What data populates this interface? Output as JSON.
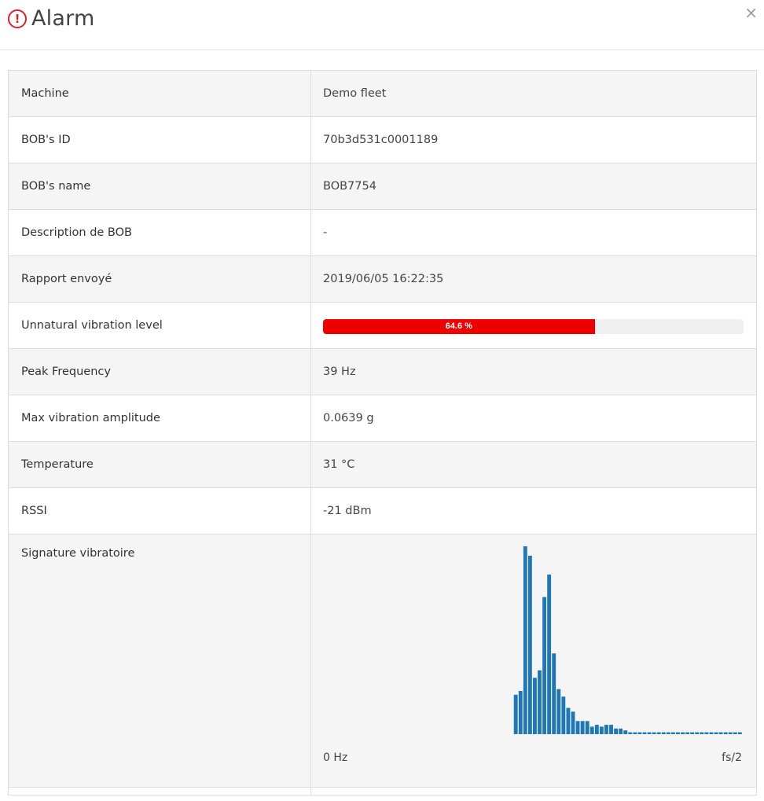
{
  "header": {
    "title": "Alarm",
    "close_label": "×",
    "alert_glyph": "!"
  },
  "rows": [
    {
      "label": "Machine",
      "value": "Demo fleet"
    },
    {
      "label": "BOB's ID",
      "value": "70b3d531c0001189"
    },
    {
      "label": "BOB's name",
      "value": "BOB7754"
    },
    {
      "label": "Description de BOB",
      "value": "-"
    },
    {
      "label": "Rapport envoyé",
      "value": "2019/06/05 16:22:35"
    },
    {
      "label": "Unnatural vibration level",
      "progress_text": "64.6 %",
      "progress_fraction": 0.646
    },
    {
      "label": "Peak Frequency",
      "value": "39 Hz"
    },
    {
      "label": "Max vibration amplitude",
      "value": "0.0639 g"
    },
    {
      "label": "Temperature",
      "value": "31 °C"
    },
    {
      "label": "RSSI",
      "value": "-21 dBm"
    },
    {
      "label": "Signature vibratoire"
    }
  ],
  "colors": {
    "alert": "#d9232d",
    "progress_fill": "#ee0000",
    "progress_track": "#eef0f2",
    "bar": "#1f77b4"
  },
  "chart_data": {
    "type": "bar",
    "x_min_label": "0 Hz",
    "x_max_label": "fs/2",
    "values": [
      0,
      0,
      0,
      0,
      0,
      0,
      0,
      0,
      0,
      0,
      0,
      0,
      0,
      0,
      0,
      0,
      0,
      0,
      0,
      0,
      0,
      0,
      0,
      0,
      0,
      0,
      0,
      0,
      0,
      0,
      0,
      0,
      0,
      0,
      0,
      0,
      0,
      0,
      0,
      0,
      0.21,
      0.23,
      1.0,
      0.95,
      0.3,
      0.34,
      0.73,
      0.85,
      0.43,
      0.24,
      0.2,
      0.14,
      0.12,
      0.07,
      0.07,
      0.07,
      0.04,
      0.05,
      0.04,
      0.05,
      0.05,
      0.03,
      0.03,
      0.02,
      0.01,
      0.01,
      0.01,
      0.01,
      0.01,
      0.01,
      0.01,
      0.01,
      0.01,
      0.01,
      0.01,
      0.01,
      0.01,
      0.01,
      0.01,
      0.01,
      0.01,
      0.01,
      0.01,
      0.01,
      0.01,
      0.01,
      0.01,
      0.01
    ],
    "ylim": [
      0,
      1
    ]
  }
}
